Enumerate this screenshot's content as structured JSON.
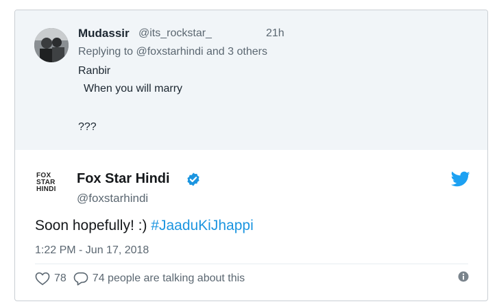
{
  "reply": {
    "name": "Mudassir",
    "handle": "@its_rockstar_",
    "time": "21h",
    "replying_to": "Replying to @foxstarhindi and 3 others",
    "lines": [
      "Ranbir",
      "When you will marry",
      "???"
    ]
  },
  "tweet": {
    "logo_lines": [
      "FOX",
      "STAR",
      "HINDI"
    ],
    "name": "Fox Star Hindi",
    "handle": "@foxstarhindi",
    "text": "Soon hopefully! :) ",
    "hashtag": "#JaaduKiJhappi",
    "timestamp": "1:22 PM - Jun 17, 2018",
    "likes": "78",
    "talking": "74 people are talking about this"
  },
  "icons": {
    "verified": "verified-badge-icon",
    "bird": "twitter-bird-icon",
    "heart": "heart-icon",
    "bubble": "comment-bubble-icon",
    "info": "info-icon"
  },
  "colors": {
    "accent": "#1b95e0",
    "reply_bg": "#f1f5f8",
    "muted_text": "#5b6771"
  }
}
